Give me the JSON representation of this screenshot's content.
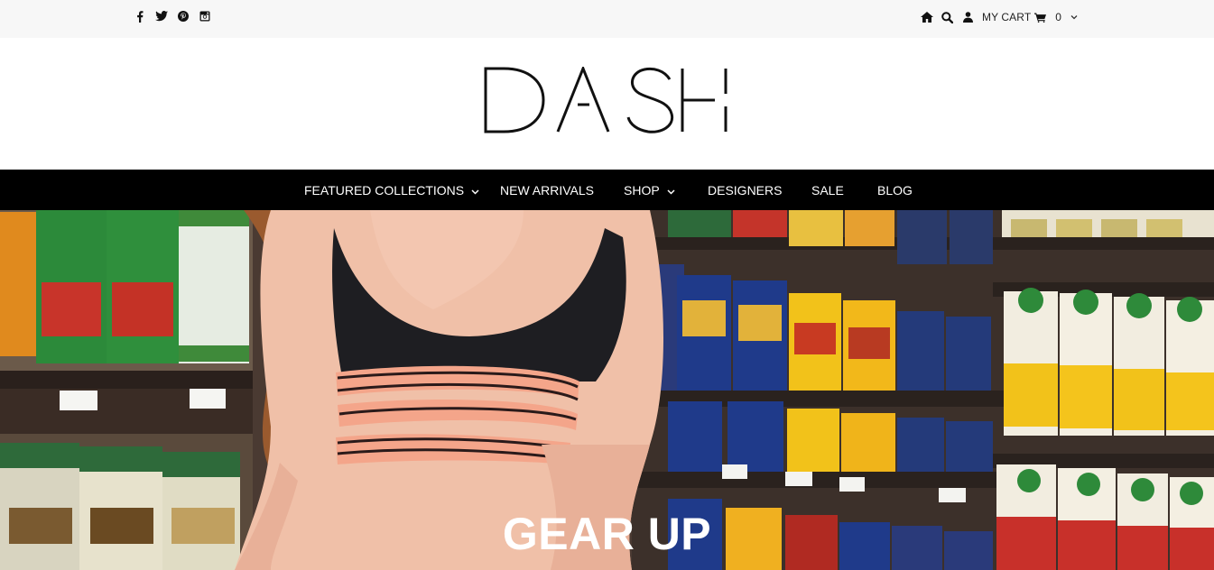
{
  "topbar": {
    "social": [
      {
        "icon": "facebook-icon"
      },
      {
        "icon": "twitter-icon"
      },
      {
        "icon": "pinterest-icon"
      },
      {
        "icon": "instagram-icon"
      }
    ],
    "home_icon": "home-icon",
    "search_icon": "search-icon",
    "account_icon": "user-icon",
    "cart_label": "MY CART",
    "cart_icon": "cart-icon",
    "cart_count": "0"
  },
  "brand": {
    "logo_text": "DASH"
  },
  "nav": {
    "items": [
      {
        "label": "FEATURED COLLECTIONS",
        "has_dropdown": true
      },
      {
        "label": "NEW ARRIVALS",
        "has_dropdown": false
      },
      {
        "label": "SHOP",
        "has_dropdown": true
      },
      {
        "label": "DESIGNERS",
        "has_dropdown": false
      },
      {
        "label": "SALE",
        "has_dropdown": false
      },
      {
        "label": "BLOG",
        "has_dropdown": false
      }
    ]
  },
  "hero": {
    "title": "GEAR UP"
  },
  "colors": {
    "topbar_bg": "#f7f7f7",
    "nav_bg": "#000000",
    "nav_text": "#ffffff",
    "accent_band": "#f4a58a"
  }
}
